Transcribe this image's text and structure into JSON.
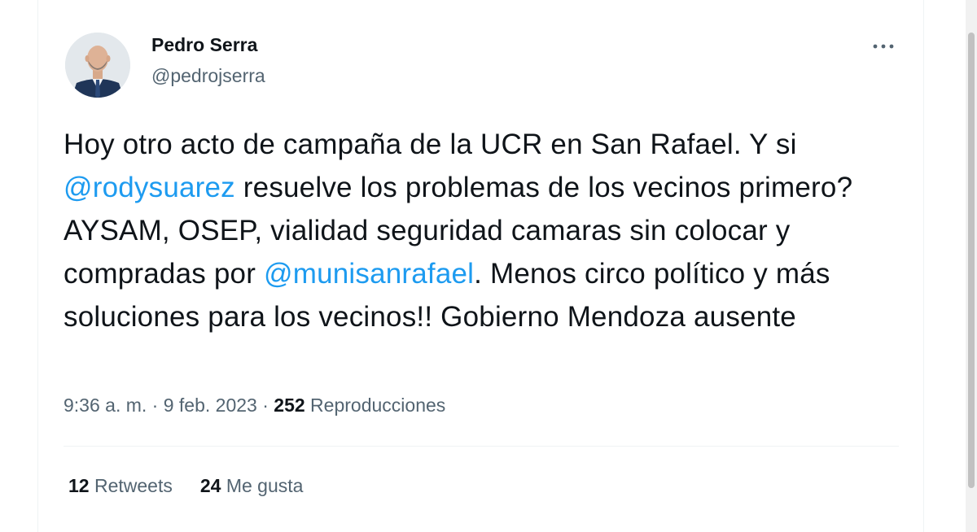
{
  "author": {
    "name": "Pedro Serra",
    "handle": "@pedrojserra"
  },
  "tweet": {
    "text_parts": [
      "Hoy otro acto de campaña de la UCR en San Rafael. Y si ",
      "@rodysuarez",
      " resuelve los problemas de los vecinos primero? AYSAM, OSEP, vialidad seguridad camaras sin colocar y compradas por ",
      "@munisanrafael",
      ". Menos circo político y más soluciones para los vecinos!! Gobierno Mendoza ausente"
    ]
  },
  "meta": {
    "time": "9:36 a. m.",
    "separator": " · ",
    "date": "9 feb. 2023",
    "views_count": "252",
    "views_label": " Reproducciones"
  },
  "stats": {
    "retweets_count": "12",
    "retweets_label": " Retweets",
    "likes_count": "24",
    "likes_label": " Me gusta"
  },
  "colors": {
    "accent": "#1d9bf0",
    "text_primary": "#0f1419",
    "text_secondary": "#536471",
    "divider": "#eff3f4"
  },
  "icons": {
    "more": "more-horizontal-icon"
  }
}
